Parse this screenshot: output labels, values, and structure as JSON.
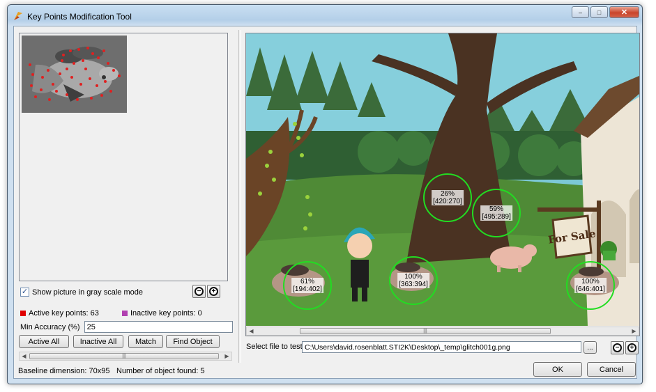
{
  "window": {
    "title": "Key Points Modification Tool",
    "controls": {
      "minimize": "–",
      "maximize": "□",
      "close": "✕"
    }
  },
  "left_panel": {
    "grayscale_checkbox": {
      "label": "Show picture in gray scale mode",
      "checked": true
    },
    "active_key_points": {
      "label": "Active key points: 63",
      "color": "#e00000"
    },
    "inactive_key_points": {
      "label": "Inactive key points: 0",
      "color": "#b040b0"
    },
    "min_accuracy": {
      "label": "Min Accuracy (%)",
      "value": "25"
    },
    "buttons": {
      "active_all": "Active All",
      "inactive_all": "Inactive All",
      "match": "Match",
      "find_object": "Find Object"
    }
  },
  "right_panel": {
    "file_select": {
      "label": "Select file to test:",
      "path": "C:\\Users\\david.rosenblatt.STI2K\\Desktop\\_temp\\glitch001g.png",
      "browse_label": "..."
    },
    "matches": [
      {
        "percent": "26%",
        "coords": "[420:270]"
      },
      {
        "percent": "59%",
        "coords": "[495:289]"
      },
      {
        "percent": "61%",
        "coords": "[194:402]"
      },
      {
        "percent": "100%",
        "coords": "[363:394]"
      },
      {
        "percent": "100%",
        "coords": "[646:401]"
      }
    ],
    "sign_text": "For Sale",
    "match_circle_color": "#22dd22"
  },
  "status_bar": {
    "baseline": "Baseline dimension: 70x95",
    "objects_found": "Number of object found: 5"
  },
  "dialog_buttons": {
    "ok": "OK",
    "cancel": "Cancel"
  },
  "scroll_thumb_glyph": "|||"
}
